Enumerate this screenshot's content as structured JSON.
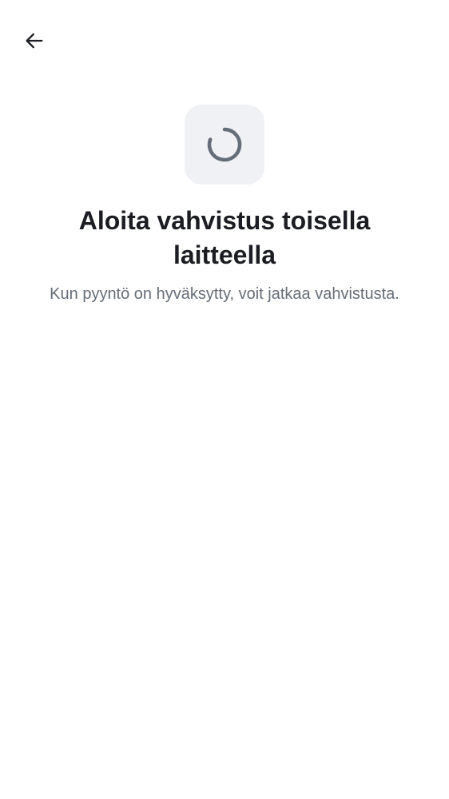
{
  "header": {
    "back_icon": "arrow-left-icon"
  },
  "status": {
    "icon": "loading-spinner-icon"
  },
  "content": {
    "title": "Aloita vahvistus toisella laitteella",
    "subtitle": "Kun pyyntö on hyväksytty, voit jatkaa vahvistusta."
  },
  "colors": {
    "background": "#ffffff",
    "title_text": "#1b1d22",
    "subtitle_text": "#656d77",
    "icon_tile": "#f0f1f5",
    "spinner": "#656d77"
  }
}
